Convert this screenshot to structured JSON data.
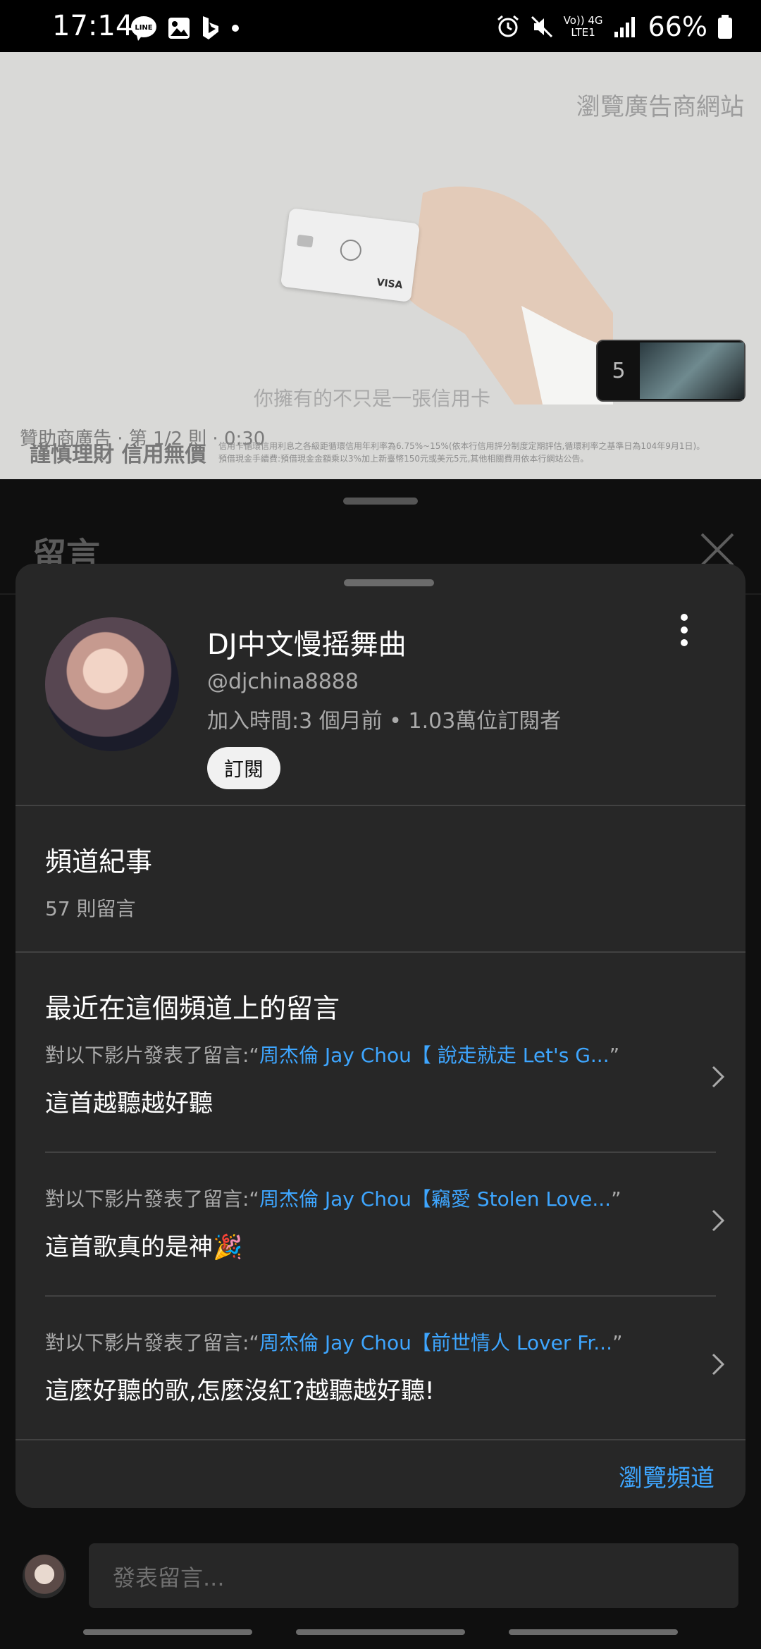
{
  "status_bar": {
    "time": "17:14",
    "battery": "66%",
    "network_top": "Vo)) 4G",
    "network_bottom": "LTE1"
  },
  "ad": {
    "advertiser_site": "瀏覽廣告商網站",
    "caption": "你擁有的不只是一張信用卡",
    "meta": "贊助商廣告 · 第 1/2 則 · 0:30",
    "tagline": "謹慎理財 信用無價",
    "fine_print_1": "信用卡循環信用利息之各級距循環信用年利率為6.75%~15%(依本行信用評分制度定期評估,循環利率之基準日為104年9月1日)。",
    "fine_print_2": "預借現金手續費:預借現金金額乘以3%加上新臺幣150元或美元5元,其他相關費用依本行網站公告。",
    "skip_countdown": "5",
    "card_brand": "VISA"
  },
  "comments_panel": {
    "title": "留言"
  },
  "channel_sheet": {
    "channel_name": "DJ中文慢摇舞曲",
    "handle": "@djchina8888",
    "joined": "加入時間:3 個月前 • 1.03萬位訂閱者",
    "subscribe_label": "訂閱",
    "history_title": "頻道紀事",
    "history_count": "57 則留言",
    "recent_title": "最近在這個頻道上的留言",
    "recent_comments": [
      {
        "prefix": "對以下影片發表了留言:“",
        "video": "周杰倫 Jay Chou【 說走就走 Let's G...",
        "suffix": "”",
        "text": "這首越聽越好聽"
      },
      {
        "prefix": "對以下影片發表了留言:“",
        "video": "周杰倫 Jay Chou【竊愛 Stolen Love...",
        "suffix": "”",
        "text": "這首歌真的是神🎉"
      },
      {
        "prefix": "對以下影片發表了留言:“",
        "video": "周杰倫 Jay Chou【前世情人 Lover Fr...",
        "suffix": "”",
        "text": "這麼好聽的歌,怎麼沒紅?越聽越好聽!"
      }
    ],
    "browse_label": "瀏覽頻道"
  },
  "composer": {
    "placeholder": "發表留言..."
  }
}
